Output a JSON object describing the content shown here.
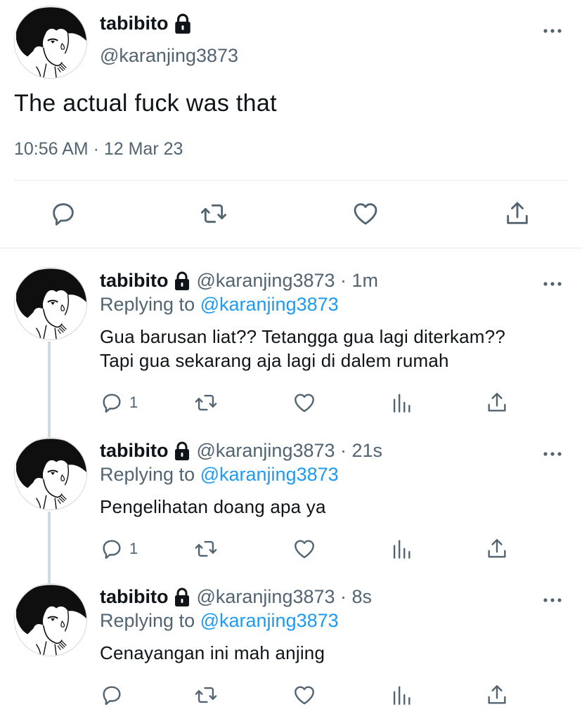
{
  "colors": {
    "text_primary": "#0f1419",
    "text_secondary": "#536471",
    "link": "#1d9bf0",
    "divider": "#e7e9ea",
    "thread_line": "#cfd9de"
  },
  "main_tweet": {
    "display_name": "tabibito",
    "protected_icon": "lock-icon",
    "handle": "@karanjing3873",
    "text": "The actual fuck was that",
    "timestamp": "10:56 AM · 12 Mar 23",
    "actions": [
      "reply-icon",
      "retweet-icon",
      "like-icon",
      "share-icon"
    ]
  },
  "replies": [
    {
      "display_name": "tabibito",
      "meta": "@karanjing3873 · 1m",
      "replying_prefix": "Replying to",
      "replying_to": "@karanjing3873",
      "lines": [
        "Gua barusan liat?? Tetangga gua lagi diterkam??",
        "Tapi gua sekarang aja lagi di dalem rumah"
      ],
      "reply_count": "1"
    },
    {
      "display_name": "tabibito",
      "meta": "@karanjing3873 · 21s",
      "replying_prefix": "Replying to",
      "replying_to": "@karanjing3873",
      "lines": [
        "Pengelihatan doang apa ya"
      ],
      "reply_count": "1"
    },
    {
      "display_name": "tabibito",
      "meta": "@karanjing3873 · 8s",
      "replying_prefix": "Replying to",
      "replying_to": "@karanjing3873",
      "lines": [
        "Cenayangan ini mah anjing"
      ],
      "reply_count": ""
    }
  ]
}
